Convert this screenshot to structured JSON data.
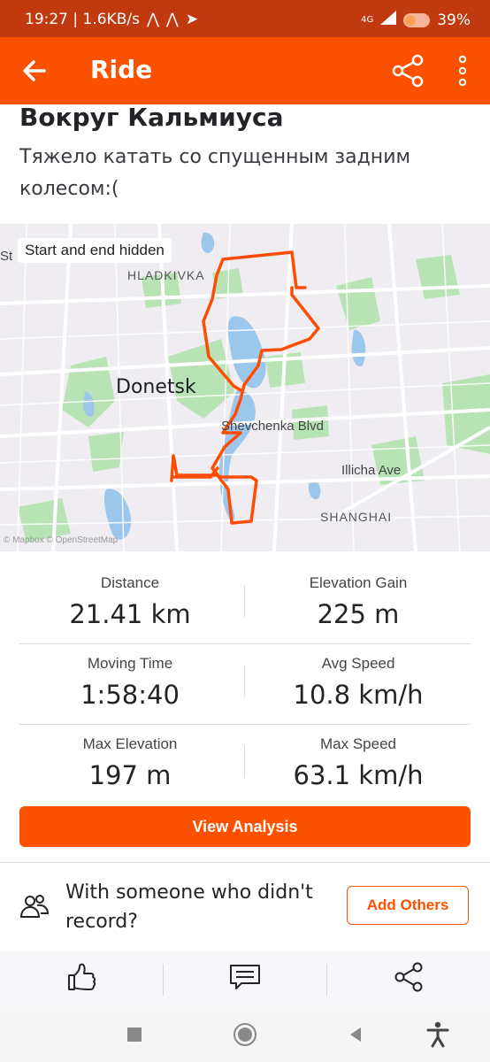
{
  "status_bar": {
    "time_speed": "19:27 | 1.6KB/s",
    "network": "4G",
    "battery": "39%"
  },
  "app_bar": {
    "title": "Ride",
    "icons": [
      "back-arrow-icon",
      "share-icon",
      "more-vert-icon"
    ]
  },
  "activity": {
    "title": "Вокруг Кальмиуса",
    "description": "Тяжело катать со спущенным задним колесом:("
  },
  "map": {
    "badge": "Start and end hidden",
    "city": "Donetsk",
    "district_top": "HLADKIVKA",
    "district_bottom": "SHANGHAI",
    "street_1": "Shevchenka Blvd",
    "street_2": "Illicha Ave",
    "edge_letters": "St",
    "attribution": "© Mapbox © OpenStreetMap",
    "route_color": "#fc5200",
    "water_color": "#9cc7ec",
    "park_color": "#b6e3b6"
  },
  "stats": [
    {
      "left": {
        "label": "Distance",
        "value": "21.41 km"
      },
      "right": {
        "label": "Elevation Gain",
        "value": "225 m"
      }
    },
    {
      "left": {
        "label": "Moving Time",
        "value": "1:58:40"
      },
      "right": {
        "label": "Avg Speed",
        "value": "10.8 km/h"
      }
    },
    {
      "left": {
        "label": "Max Elevation",
        "value": "197 m"
      },
      "right": {
        "label": "Max Speed",
        "value": "63.1 km/h"
      }
    }
  ],
  "buttons": {
    "view_analysis": "View Analysis",
    "add_others": "Add Others"
  },
  "with_others": {
    "text": "With someone who didn't record?"
  },
  "actions": [
    "thumbs-up-icon",
    "comment-icon",
    "share-icon"
  ],
  "nav_bar": [
    "recents-square-icon",
    "home-circle-icon",
    "back-triangle-icon",
    "accessibility-icon"
  ],
  "colors": {
    "brand": "#fc5200",
    "status_bar": "#c13a0f"
  }
}
